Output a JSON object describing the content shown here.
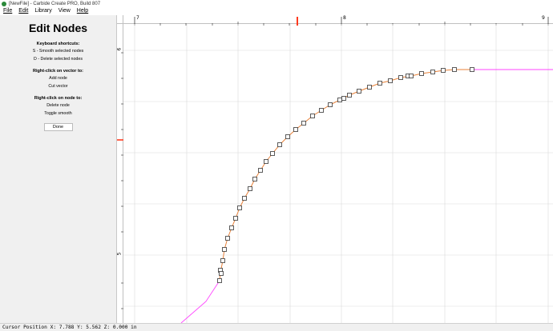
{
  "window": {
    "title": "[NewFile] - Carbide Create PRO, Build 807"
  },
  "menu": {
    "items": [
      "File",
      "Edit",
      "Library",
      "View",
      "Help"
    ]
  },
  "sidebar": {
    "title": "Edit Nodes",
    "sections": [
      {
        "title": "Keyboard shortcuts:",
        "lines": [
          "S - Smooth selected nodes",
          "D - Delete selected nodes"
        ]
      },
      {
        "title": "Right-click on vector to:",
        "lines": [
          "Add node",
          "Cut vector"
        ]
      },
      {
        "title": "Right-click on node to:",
        "lines": [
          "Delete node",
          "Toggle smooth"
        ]
      }
    ],
    "done_label": "Done"
  },
  "rulers": {
    "horizontal": [
      "7",
      "8",
      "9"
    ],
    "vertical": [
      "6",
      "5"
    ]
  },
  "colors": {
    "curve": "#e8823a",
    "node_fill": "#ffffff",
    "node_stroke": "#333333",
    "other_vector": "#ff44ff",
    "cursor_marker": "#ff3b1f",
    "grid": "#d9d9d9"
  },
  "status": {
    "cursor_position": "Cursor Position X: 7.788 Y: 5.562 Z: 0.000 in"
  }
}
